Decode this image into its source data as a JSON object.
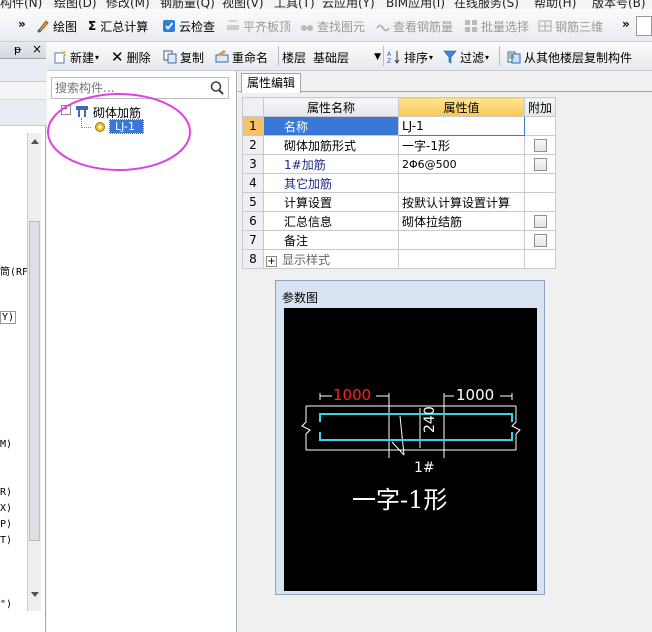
{
  "menubar": {
    "items": [
      "构件(N)",
      "绘图(D)",
      "修改(M)",
      "钢筋量(Q)",
      "视图(V)",
      "工具(T)",
      "云应用(Y)",
      "BIM应用(I)",
      "在线服务(S)",
      "帮助(H)",
      "版本号(B)"
    ]
  },
  "toolbar1": {
    "overflow": "»",
    "draw": "绘图",
    "sum_icon": "Σ",
    "summary": "汇总计算",
    "cloud_check": "云检查",
    "flatten": "平齐板顶",
    "find": "查找图元",
    "view_rebar": "查看钢筋量",
    "batch_select": "批量选择",
    "rebar_3d": "钢筋三维",
    "overflow2": "»"
  },
  "leftpanel": {
    "pin": "ᵽ",
    "close": "×",
    "frag1": "筒(RF",
    "frag2": "Y)",
    "frag3": "M)",
    "frag4": "R)",
    "frag5": "X)",
    "frag6": "P)",
    "frag7": "T)",
    "frag8": "\")"
  },
  "toolbar2": {
    "new": "新建",
    "delete": "删除",
    "copy": "复制",
    "rename": "重命名",
    "floor_label": "楼层",
    "floor_value": "基础层",
    "sort": "排序",
    "filter": "过滤",
    "copy_from_floor": "从其他楼层复制构件"
  },
  "tree": {
    "search_placeholder": "搜索构件...",
    "root_label": "砌体加筋",
    "child_label": "LJ-1",
    "expand": "-"
  },
  "properties": {
    "tab": "属性编辑",
    "headers": {
      "name": "属性名称",
      "value": "属性值",
      "extra": "附加"
    },
    "rows": [
      {
        "num": "1",
        "name": "名称",
        "value": "LJ-1"
      },
      {
        "num": "2",
        "name": "砌体加筋形式",
        "value": "一字-1形"
      },
      {
        "num": "3",
        "name": "1#加筋",
        "value": "2Φ6@500"
      },
      {
        "num": "4",
        "name": "其它加筋",
        "value": ""
      },
      {
        "num": "5",
        "name": "计算设置",
        "value": "按默认计算设置计算"
      },
      {
        "num": "6",
        "name": "汇总信息",
        "value": "砌体拉结筋"
      },
      {
        "num": "7",
        "name": "备注",
        "value": ""
      },
      {
        "num": "8",
        "name": "显示样式",
        "value": "",
        "expander": "+"
      }
    ]
  },
  "param_figure": {
    "title": "参数图",
    "dim_left": "1000",
    "dim_right": "1000",
    "dim_vertical": "240",
    "bar_label": "1#",
    "shape_name": "一字-1形"
  },
  "colors": {
    "accent_blue": "#3a78d8",
    "value_header": "#f9c94e",
    "rebar_cyan": "#35d6e6",
    "dim_red": "#ff2020",
    "annotation_circle": "#e040e0"
  }
}
